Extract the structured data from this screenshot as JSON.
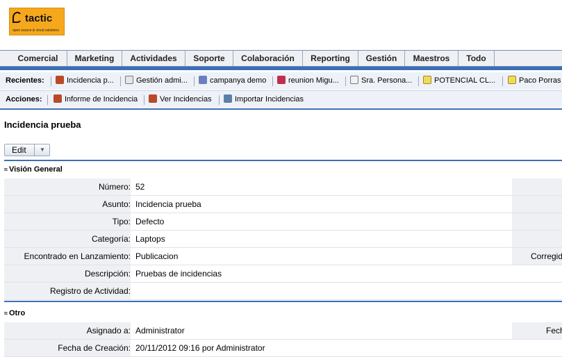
{
  "logo": {
    "word": "tactic",
    "tagline": "open source & cloud solutions"
  },
  "nav": [
    "Comercial",
    "Marketing",
    "Actividades",
    "Soporte",
    "Colaboración",
    "Reporting",
    "Gestión",
    "Maestros",
    "Todo"
  ],
  "recent": {
    "label": "Recientes:",
    "items": [
      {
        "label": "Incidencia p...",
        "icon": "bug-icon"
      },
      {
        "label": "Gestión admi...",
        "icon": "document-icon"
      },
      {
        "label": "campanya demo",
        "icon": "campaign-icon"
      },
      {
        "label": "reunion Migu...",
        "icon": "meeting-icon"
      },
      {
        "label": "Sra. Persona...",
        "icon": "contact-card-icon"
      },
      {
        "label": "POTENCIAL CL...",
        "icon": "folder-icon"
      },
      {
        "label": "Paco Porras",
        "icon": "folder-icon"
      }
    ]
  },
  "actions": {
    "label": "Acciones:",
    "items": [
      {
        "label": "Informe de Incidencia",
        "icon": "bug-add-icon"
      },
      {
        "label": "Ver Incidencias",
        "icon": "bug-list-icon"
      },
      {
        "label": "Importar Incidencias",
        "icon": "import-icon"
      }
    ]
  },
  "record": {
    "title": "Incidencia prueba",
    "edit_label": "Edit"
  },
  "sections": {
    "general": {
      "title": "Visión General",
      "fields": [
        {
          "label": "Número:",
          "value": "52",
          "right": ""
        },
        {
          "label": "Asunto:",
          "value": "Incidencia prueba",
          "right": ""
        },
        {
          "label": "Tipo:",
          "value": "Defecto",
          "right": ""
        },
        {
          "label": "Categoría:",
          "value": "Laptops",
          "right": ""
        },
        {
          "label": "Encontrado en Lanzamiento:",
          "value": "Publicacion",
          "right": "Corregido"
        },
        {
          "label": "Descripción:",
          "value": "Pruebas de incidencias",
          "right": ""
        },
        {
          "label": "Registro de Actividad:",
          "value": "",
          "right": ""
        }
      ]
    },
    "other": {
      "title": "Otro",
      "fields": [
        {
          "label": "Asignado a:",
          "value": "Administrator",
          "right": "Fecha"
        },
        {
          "label": "Fecha de Creación:",
          "value": "20/11/2012 09:16 por Administrator",
          "right": ""
        }
      ]
    }
  },
  "colors": {
    "accent": "#3b6fb6",
    "nav_bg": "#eef0f4",
    "label_bg": "#eef0f3",
    "logo": "#f6a81c"
  }
}
